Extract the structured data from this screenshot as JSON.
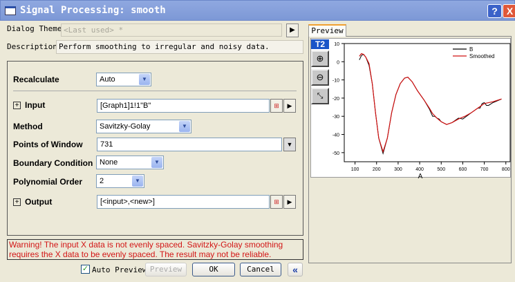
{
  "window": {
    "title": "Signal Processing: smooth",
    "help": "?",
    "close": "X"
  },
  "theme": {
    "label": "Dialog Theme",
    "value": "<Last used> *"
  },
  "description": {
    "label": "Description",
    "value": "Perform smoothing to irregular and noisy data."
  },
  "form": {
    "recalculate": {
      "label": "Recalculate",
      "value": "Auto"
    },
    "input": {
      "label": "Input",
      "value": "[Graph1]1!1\"B\""
    },
    "method": {
      "label": "Method",
      "value": "Savitzky-Golay"
    },
    "points": {
      "label": "Points of Window",
      "value": "731"
    },
    "boundary": {
      "label": "Boundary Condition",
      "value": "None"
    },
    "poly": {
      "label": "Polynomial Order",
      "value": "2"
    },
    "output": {
      "label": "Output",
      "value": "[<input>,<new>]"
    }
  },
  "warning": "Warning! The input X data is not evenly spaced. Savitzky-Golay smoothing requires the X data to be evenly spaced. The result may not be reliable.",
  "buttons": {
    "auto_preview": "Auto Preview",
    "preview": "Preview",
    "ok": "OK",
    "cancel": "Cancel",
    "collapse": "«"
  },
  "preview": {
    "tab": "Preview",
    "badge": "T2"
  },
  "chart_data": {
    "type": "line",
    "xlabel": "A",
    "ylabel": "",
    "xlim": [
      50,
      820
    ],
    "ylim": [
      -55,
      10
    ],
    "xticks": [
      100,
      200,
      300,
      400,
      500,
      600,
      700,
      800
    ],
    "yticks": [
      10,
      0,
      -10,
      -20,
      -30,
      -40,
      -50
    ],
    "legend": [
      "B",
      "Smoothed"
    ],
    "legend_position": "top-right",
    "colors": {
      "B": "#000000",
      "Smoothed": "#d01010"
    },
    "series": [
      {
        "name": "B",
        "x": [
          120,
          130,
          140,
          150,
          165,
          180,
          195,
          210,
          230,
          250,
          270,
          290,
          310,
          330,
          345,
          365,
          390,
          420,
          445,
          460,
          470,
          480,
          490,
          500,
          525,
          550,
          580,
          600,
          640,
          670,
          680,
          690,
          700,
          710,
          720,
          740,
          780
        ],
        "y": [
          1,
          3.5,
          4,
          2.5,
          -2,
          -12,
          -28,
          -42,
          -50.5,
          -42,
          -28,
          -18,
          -12,
          -9,
          -8.5,
          -11,
          -16,
          -21,
          -26,
          -30,
          -30,
          -31,
          -31.5,
          -33,
          -34.5,
          -33.5,
          -31,
          -31.5,
          -28,
          -25.5,
          -25.5,
          -23,
          -22.5,
          -24,
          -24,
          -22.5,
          -20.5
        ]
      },
      {
        "name": "Smoothed",
        "x": [
          120,
          130,
          140,
          150,
          165,
          180,
          195,
          210,
          230,
          250,
          270,
          290,
          310,
          330,
          345,
          365,
          390,
          420,
          445,
          460,
          480,
          500,
          525,
          550,
          580,
          610,
          640,
          670,
          700,
          740,
          780
        ],
        "y": [
          3,
          4.5,
          4,
          2.5,
          -1,
          -12,
          -28,
          -42,
          -49.5,
          -42,
          -28,
          -18,
          -12,
          -9,
          -8.5,
          -11,
          -16,
          -21,
          -25.5,
          -28.5,
          -31,
          -33,
          -34.5,
          -33.5,
          -31.5,
          -30,
          -28,
          -25.5,
          -23,
          -22,
          -20.5
        ]
      }
    ]
  }
}
